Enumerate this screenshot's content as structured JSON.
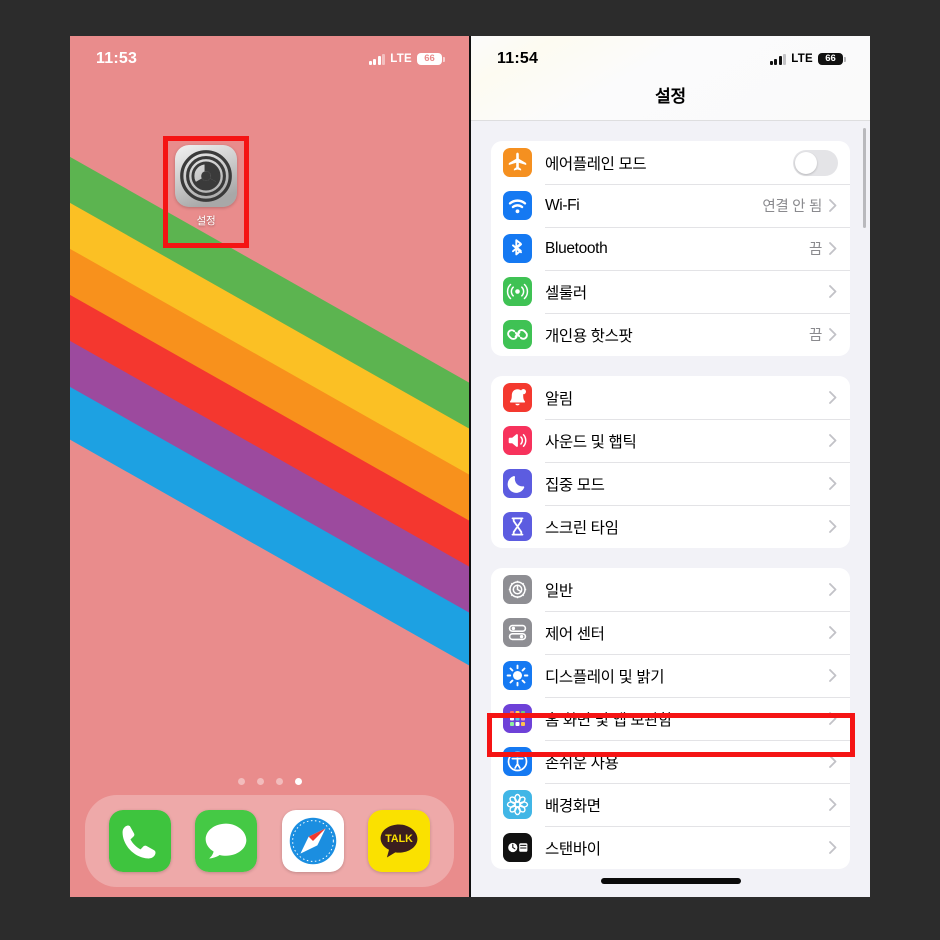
{
  "canvas": {
    "background": "#2c2c2c"
  },
  "home_screen": {
    "status_bar": {
      "time": "11:53",
      "network": "LTE",
      "battery": "66"
    },
    "wallpaper": {
      "base_color": "#e98c8c",
      "stripes": [
        "#5cb450",
        "#fbc024",
        "#f8911c",
        "#f4372f",
        "#9c4a9e",
        "#1da1e2"
      ]
    },
    "app": {
      "label": "설정",
      "icon": "settings-gear-icon"
    },
    "page_dots": {
      "count": 4,
      "active_index": 3
    },
    "dock": [
      {
        "name": "phone",
        "label": "전화",
        "color": "#3ec43e"
      },
      {
        "name": "messages",
        "label": "메시지",
        "color": "#45c945"
      },
      {
        "name": "safari",
        "label": "Safari",
        "color": "#ffffff"
      },
      {
        "name": "kakaotalk",
        "label": "TALK",
        "color": "#fae100"
      }
    ],
    "highlight": "settings-app-icon"
  },
  "settings_screen": {
    "status_bar": {
      "time": "11:54",
      "network": "LTE",
      "battery": "66"
    },
    "title": "설정",
    "highlight": "display-and-brightness-row",
    "groups": [
      {
        "id": "connectivity",
        "rows": [
          {
            "label": "에어플레인 모드",
            "icon": "airplane-icon",
            "icon_color": "#f59020",
            "control": "toggle",
            "toggle_on": false
          },
          {
            "label": "Wi-Fi",
            "icon": "wifi-icon",
            "icon_color": "#1579f2",
            "value": "연결 안 됨",
            "control": "chevron"
          },
          {
            "label": "Bluetooth",
            "icon": "bluetooth-icon",
            "icon_color": "#1579f2",
            "value": "끔",
            "control": "chevron"
          },
          {
            "label": "셀룰러",
            "icon": "cellular-icon",
            "icon_color": "#3fc254",
            "value": "",
            "control": "chevron"
          },
          {
            "label": "개인용 핫스팟",
            "icon": "hotspot-icon",
            "icon_color": "#3fc254",
            "value": "끔",
            "control": "chevron"
          }
        ]
      },
      {
        "id": "alerts",
        "rows": [
          {
            "label": "알림",
            "icon": "bell-icon",
            "icon_color": "#f4392f",
            "value": "",
            "control": "chevron"
          },
          {
            "label": "사운드 및 햅틱",
            "icon": "speaker-icon",
            "icon_color": "#f7325c",
            "value": "",
            "control": "chevron"
          },
          {
            "label": "집중 모드",
            "icon": "moon-icon",
            "icon_color": "#5c5ce0",
            "value": "",
            "control": "chevron"
          },
          {
            "label": "스크린 타임",
            "icon": "hourglass-icon",
            "icon_color": "#5c5ce0",
            "value": "",
            "control": "chevron"
          }
        ]
      },
      {
        "id": "system",
        "rows": [
          {
            "label": "일반",
            "icon": "gear-icon",
            "icon_color": "#8e8e93",
            "value": "",
            "control": "chevron"
          },
          {
            "label": "제어 센터",
            "icon": "control-center-icon",
            "icon_color": "#8e8e93",
            "value": "",
            "control": "chevron"
          },
          {
            "label": "디스플레이 및 밝기",
            "icon": "brightness-icon",
            "icon_color": "#1579f2",
            "value": "",
            "control": "chevron"
          },
          {
            "label": "홈 화면 및 앱 보관함",
            "icon": "home-screen-icon",
            "icon_color": "#6e41d8",
            "value": "",
            "control": "chevron"
          },
          {
            "label": "손쉬운 사용",
            "icon": "accessibility-icon",
            "icon_color": "#1579f2",
            "value": "",
            "control": "chevron"
          },
          {
            "label": "배경화면",
            "icon": "wallpaper-icon",
            "icon_color": "#41b6e6",
            "value": "",
            "control": "chevron"
          },
          {
            "label": "스탠바이",
            "icon": "standby-icon",
            "icon_color": "#111111",
            "value": "",
            "control": "chevron"
          }
        ]
      }
    ]
  }
}
